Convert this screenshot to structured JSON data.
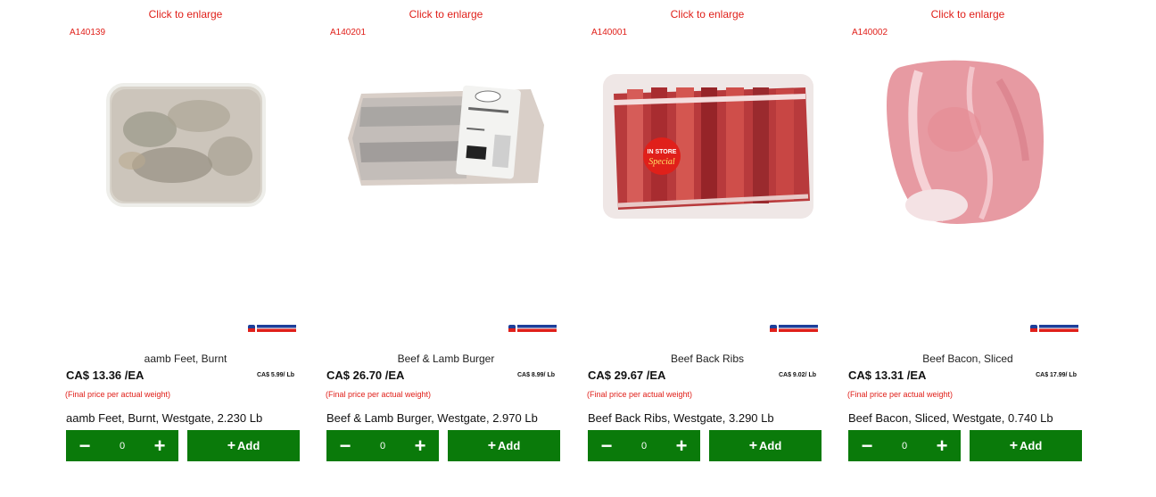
{
  "colors": {
    "accent_red": "#e0201a",
    "button_green": "#0a7a0a"
  },
  "products": [
    {
      "enlarge": "Click to enlarge",
      "sku": "A140139",
      "name": "aamb Feet, Burnt",
      "price": "CA$ 13.36 /EA",
      "unit_price": "CA$ 5.99/ Lb",
      "note": "(Final price per actual weight)",
      "desc": "aamb Feet, Burnt, Westgate, 2.230 Lb",
      "qty": "0",
      "add_label": "Add",
      "image_icon": "lamb-feet-package-image"
    },
    {
      "enlarge": "Click to enlarge",
      "sku": "A140201",
      "name": "Beef & Lamb Burger",
      "price": "CA$ 26.70 /EA",
      "unit_price": "CA$ 8.99/ Lb",
      "note": "(Final price per actual weight)",
      "desc": "Beef & Lamb Burger, Westgate, 2.970 Lb",
      "qty": "0",
      "add_label": "Add",
      "image_icon": "burger-package-image"
    },
    {
      "enlarge": "Click to enlarge",
      "sku": "A140001",
      "name": "Beef Back Ribs",
      "price": "CA$ 29.67 /EA",
      "unit_price": "CA$ 9.02/ Lb",
      "note": "(Final price per actual weight)",
      "desc": "Beef Back Ribs, Westgate, 3.290 Lb",
      "qty": "0",
      "add_label": "Add",
      "image_icon": "back-ribs-package-image",
      "sticker": {
        "line1": "IN STORE",
        "line2": "Special"
      }
    },
    {
      "enlarge": "Click to enlarge",
      "sku": "A140002",
      "name": "Beef Bacon, Sliced",
      "price": "CA$ 13.31 /EA",
      "unit_price": "CA$ 17.99/ Lb",
      "note": "(Final price per actual weight)",
      "desc": "Beef Bacon, Sliced, Westgate, 0.740 Lb",
      "qty": "0",
      "add_label": "Add",
      "image_icon": "beef-bacon-image"
    }
  ]
}
